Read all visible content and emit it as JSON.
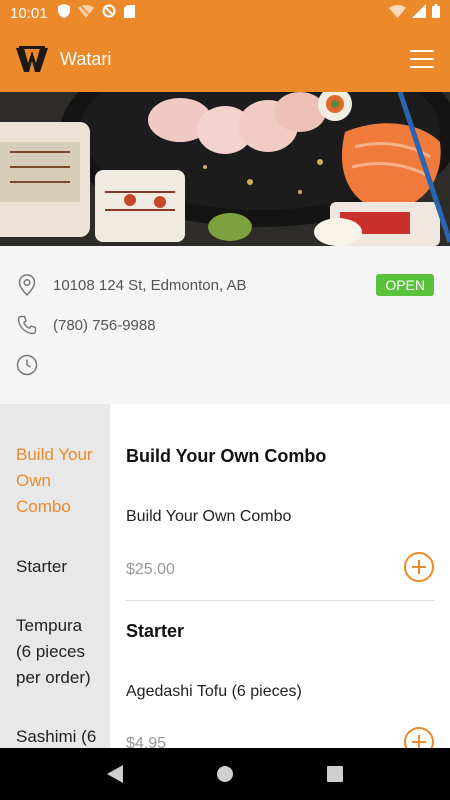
{
  "status_bar": {
    "time": "10:01",
    "icons": [
      "shield-icon",
      "wifi-off-icon",
      "no-sync-icon",
      "sd-card-icon"
    ],
    "right_icons": [
      "wifi-x-icon",
      "signal-icon",
      "battery-icon"
    ]
  },
  "app": {
    "title": "Watari",
    "brand_color": "#ec8a2b",
    "logo_icon": "watari-w-logo"
  },
  "restaurant": {
    "address": "10108 124 St, Edmonton, AB",
    "phone": "(780) 756-9988",
    "hours": "",
    "status": "OPEN",
    "status_color": "#5ac23b"
  },
  "categories": [
    {
      "label": "Build Your Own Combo",
      "active": true
    },
    {
      "label": "Starter",
      "active": false
    },
    {
      "label": "Tempura (6 pieces per order)",
      "active": false
    },
    {
      "label": "Sashimi (6",
      "active": false
    }
  ],
  "menu": {
    "sections": [
      {
        "title": "Build Your Own Combo",
        "items": [
          {
            "name": "Build Your Own Combo",
            "price": "$25.00"
          }
        ]
      },
      {
        "title": "Starter",
        "items": [
          {
            "name": "Agedashi Tofu (6 pieces)",
            "price": "$4.95"
          }
        ]
      }
    ]
  }
}
